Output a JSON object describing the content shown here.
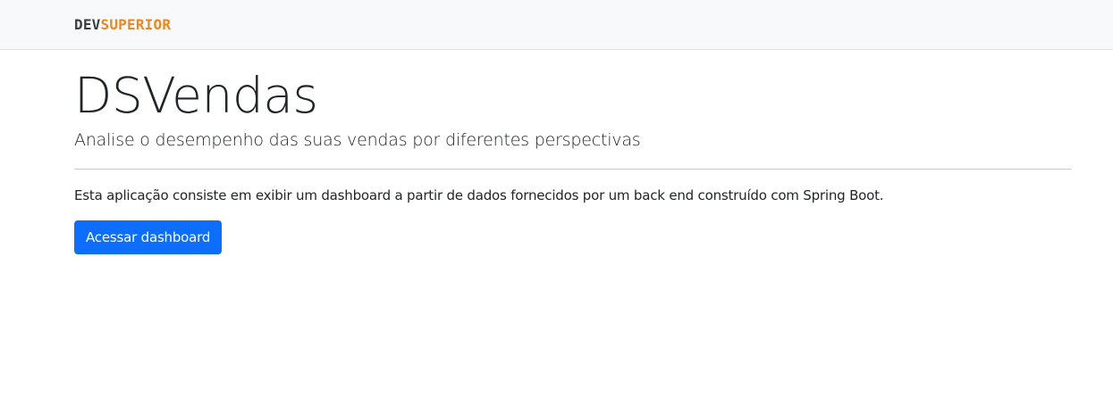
{
  "navbar": {
    "brand_dev": "DEV",
    "brand_superior": "SUPERIOR"
  },
  "main": {
    "title": "DSVendas",
    "lead": "Analise o desempenho das suas vendas por diferentes perspectivas",
    "description": "Esta aplicação consiste em exibir um dashboard a partir de dados fornecidos por um back end construído com Spring Boot.",
    "button_label": "Acessar dashboard"
  },
  "colors": {
    "navbar_bg": "#f8f9fa",
    "brand_dark": "#3d3d3d",
    "brand_accent": "#f0861e",
    "primary": "#0d6efd"
  }
}
